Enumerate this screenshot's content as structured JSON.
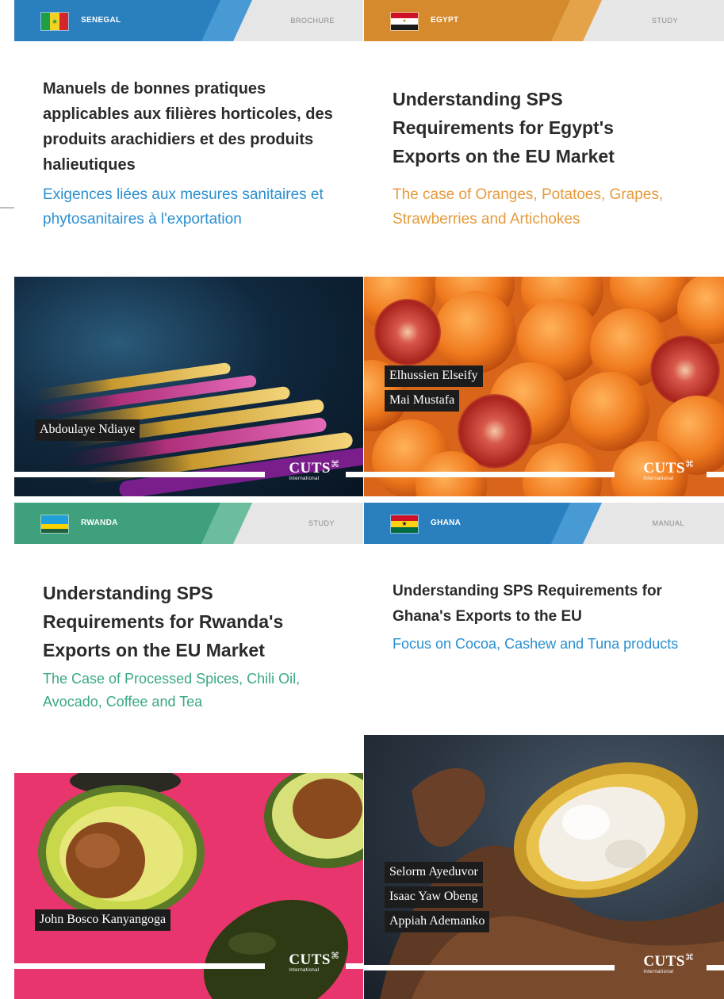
{
  "cards": [
    {
      "country": "SENEGAL",
      "doctype": "BROCHURE",
      "title": "Manuels de bonnes pratiques applicables aux filières horticoles, des produits arachidiers et des produits halieutiques",
      "subtitle": "Exigences liées aux mesures sanitaires et phytosanitaires à l'exportation",
      "authors": [
        "Abdoulaye Ndiaye"
      ],
      "publisher": "CUTS",
      "publisher_sub": "International",
      "colors": {
        "band": "#2a7fbf",
        "subtitle": "#2a8fd0",
        "flag": [
          "#1f9e45",
          "#f3d321",
          "#d3262a"
        ]
      }
    },
    {
      "country": "EGYPT",
      "doctype": "STUDY",
      "title": "Understanding SPS Requirements for Egypt's Exports on the EU Market",
      "subtitle": "The case of Oranges, Potatoes, Grapes, Strawberries and Artichokes",
      "authors": [
        "Elhussien Elseify",
        "Mai Mustafa"
      ],
      "publisher": "CUTS",
      "publisher_sub": "International",
      "colors": {
        "band": "#d68a2e",
        "subtitle": "#e59a3c",
        "flag": [
          "#ce1126",
          "#ffffff",
          "#1a1a1a"
        ]
      }
    },
    {
      "country": "RWANDA",
      "doctype": "STUDY",
      "title": "Understanding SPS Requirements for Rwanda's Exports on the EU Market",
      "subtitle": "The Case of Processed Spices, Chili Oil, Avocado, Coffee and Tea",
      "authors": [
        "John Bosco Kanyangoga"
      ],
      "publisher": "CUTS",
      "publisher_sub": "International",
      "colors": {
        "band": "#3fa07e",
        "subtitle": "#38a886",
        "flag": [
          "#20a0d8",
          "#fad201",
          "#20603d"
        ]
      }
    },
    {
      "country": "GHANA",
      "doctype": "MANUAL",
      "title": "Understanding SPS Requirements for Ghana's Exports to the EU",
      "subtitle": "Focus on Cocoa, Cashew and Tuna products",
      "authors": [
        "Selorm Ayeduvor",
        "Isaac Yaw Obeng",
        "Appiah Ademanko"
      ],
      "publisher": "CUTS",
      "publisher_sub": "International",
      "colors": {
        "band": "#2a7fbf",
        "subtitle": "#2a8fd0",
        "flag": [
          "#ce1126",
          "#fcd116",
          "#006b3f"
        ]
      }
    }
  ]
}
